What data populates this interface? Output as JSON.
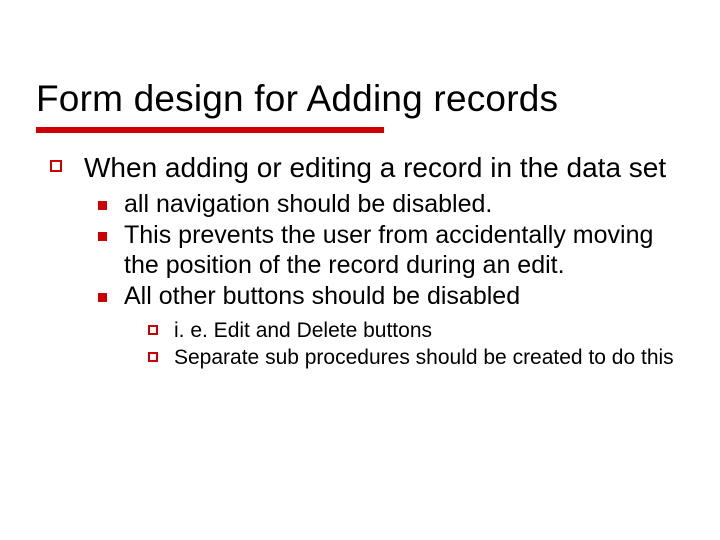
{
  "title": "Form design for Adding records",
  "bullets": {
    "l1": "When adding or editing a record in the data set",
    "l2a": "all navigation should be disabled.",
    "l2b": "This prevents the user from accidentally moving the position of the record during an edit.",
    "l2c": "All other buttons should be disabled",
    "l3a": "i. e. Edit and Delete buttons",
    "l3b": "Separate sub procedures should be created to do this"
  },
  "accent_color": "#cc0000"
}
